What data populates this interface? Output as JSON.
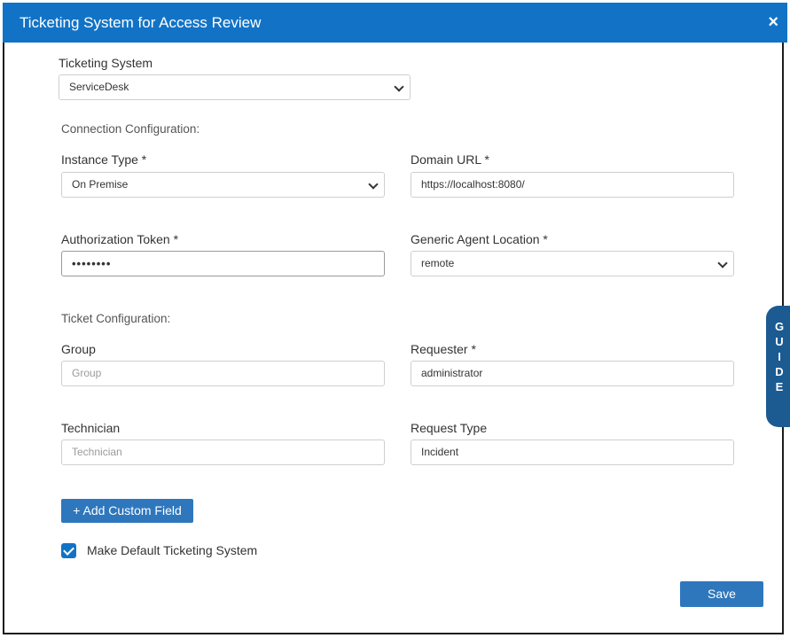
{
  "header": {
    "title": "Ticketing System for Access Review",
    "close_glyph": "×"
  },
  "ticketing_system": {
    "label": "Ticketing System",
    "value": "ServiceDesk"
  },
  "connection": {
    "heading": "Connection Configuration:",
    "instance_type": {
      "label": "Instance Type *",
      "value": "On Premise"
    },
    "domain_url": {
      "label": "Domain URL *",
      "value": "https://localhost:8080/"
    },
    "auth_token": {
      "label": "Authorization Token *",
      "value": "••••••••"
    },
    "agent_location": {
      "label": "Generic Agent Location *",
      "value": "remote"
    }
  },
  "ticket": {
    "heading": "Ticket Configuration:",
    "group": {
      "label": "Group",
      "placeholder": "Group"
    },
    "requester": {
      "label": "Requester *",
      "value": "administrator"
    },
    "technician": {
      "label": "Technician",
      "placeholder": "Technician"
    },
    "request_type": {
      "label": "Request Type",
      "value": "Incident"
    }
  },
  "add_custom_field": "+ Add Custom Field",
  "default_checkbox": {
    "label": "Make Default Ticketing System",
    "checked": true
  },
  "save": "Save",
  "guide": [
    "G",
    "U",
    "I",
    "D",
    "E"
  ],
  "colors": {
    "header_bg": "#1273c6",
    "button_bg": "#2f77bd",
    "guide_bg": "#1c5a92"
  }
}
